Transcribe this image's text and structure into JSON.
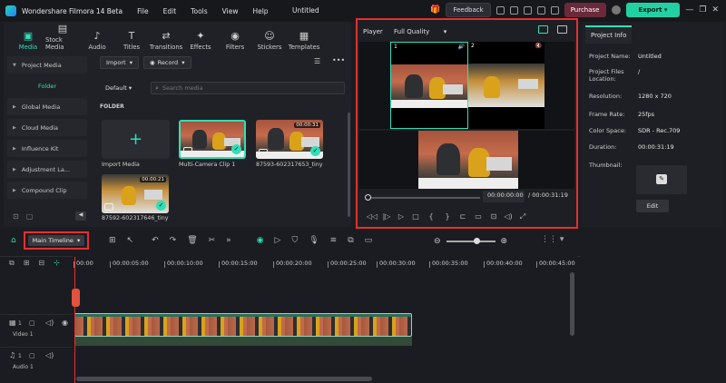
{
  "titlebar": {
    "app_name": "Wondershare Filmora 14 Beta",
    "menu": [
      "File",
      "Edit",
      "Tools",
      "View",
      "Help"
    ],
    "doc_title": "Untitled",
    "feedback": "Feedback",
    "purchase": "Purchase",
    "export": "Export"
  },
  "toolbar_tabs": [
    {
      "label": "Media",
      "icon": "media-icon",
      "glyph": "▣"
    },
    {
      "label": "Stock Media",
      "icon": "stock-media-icon",
      "glyph": "▤"
    },
    {
      "label": "Audio",
      "icon": "audio-icon",
      "glyph": "♪"
    },
    {
      "label": "Titles",
      "icon": "titles-icon",
      "glyph": "T"
    },
    {
      "label": "Transitions",
      "icon": "transitions-icon",
      "glyph": "⇄"
    },
    {
      "label": "Effects",
      "icon": "effects-icon",
      "glyph": "✦"
    },
    {
      "label": "Filters",
      "icon": "filters-icon",
      "glyph": "◉"
    },
    {
      "label": "Stickers",
      "icon": "stickers-icon",
      "glyph": "☺"
    },
    {
      "label": "Templates",
      "icon": "templates-icon",
      "glyph": "▦"
    }
  ],
  "sidebar": {
    "items": [
      {
        "label": "Project Media"
      },
      {
        "label": "Folder"
      },
      {
        "label": "Global Media"
      },
      {
        "label": "Cloud Media"
      },
      {
        "label": "Influence Kit"
      },
      {
        "label": "Adjustment La..."
      },
      {
        "label": "Compound Clip"
      }
    ]
  },
  "media": {
    "import_label": "Import",
    "record_label": "Record",
    "sort_label": "Default",
    "search_placeholder": "Search media",
    "folder_label": "FOLDER",
    "items": [
      {
        "label": "Import Media",
        "duration": ""
      },
      {
        "label": "Multi-Camera Clip 1",
        "duration": ""
      },
      {
        "label": "87593-602317653_tiny",
        "duration": "00:00:31"
      },
      {
        "label": "87592-602317646_tiny",
        "duration": "00:00:21"
      }
    ]
  },
  "player": {
    "label": "Player",
    "quality": "Full Quality",
    "cam1": "1",
    "cam2": "2",
    "current_time": "00:00:00:00",
    "total_time": "/ 00:00:31:19"
  },
  "project_info": {
    "tab": "Project Info",
    "rows": [
      {
        "key": "Project Name:",
        "value": "Untitled"
      },
      {
        "key": "Project Files Location:",
        "value": "/"
      },
      {
        "key": "Resolution:",
        "value": "1280 x 720"
      },
      {
        "key": "Frame Rate:",
        "value": "25fps"
      },
      {
        "key": "Color Space:",
        "value": "SDR - Rec.709"
      },
      {
        "key": "Duration:",
        "value": "00:00:31:19"
      },
      {
        "key": "Thumbnail:",
        "value": ""
      }
    ],
    "edit": "Edit"
  },
  "timeline": {
    "main_timeline": "Main Timeline",
    "ticks": [
      "00:00",
      "00:00:05:00",
      "00:00:10:00",
      "00:00:15:00",
      "00:00:20:00",
      "00:00:25:00",
      "00:00:30:00",
      "00:00:35:00",
      "00:00:40:00",
      "00:00:45:00"
    ],
    "video_track": "Video 1",
    "audio_track": "Audio 1",
    "video_num": "1",
    "audio_num": "1"
  },
  "colors": {
    "accent": "#2ee0b8",
    "highlight": "#e52f2f"
  }
}
